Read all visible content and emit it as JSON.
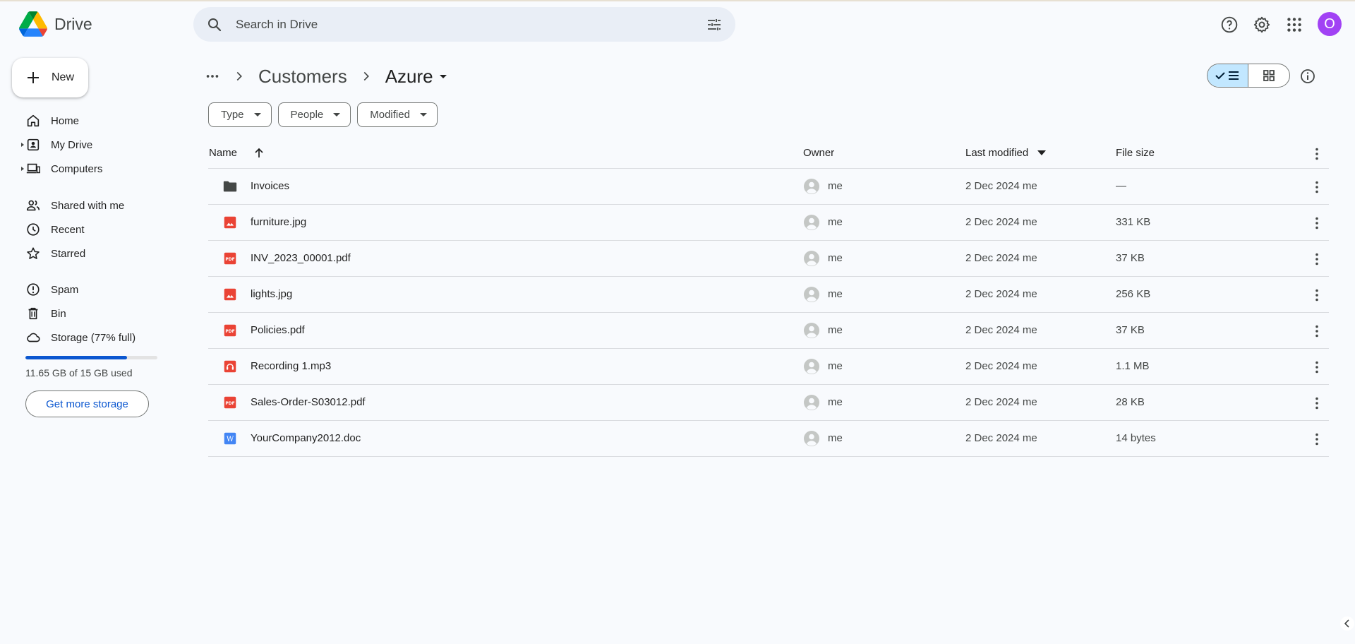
{
  "app": {
    "name": "Drive"
  },
  "search": {
    "placeholder": "Search in Drive"
  },
  "header": {
    "avatar_letter": "O",
    "accent": "#a142f4"
  },
  "sidebar": {
    "new_label": "New",
    "items": [
      {
        "label": "Home",
        "icon": "home-icon"
      },
      {
        "label": "My Drive",
        "icon": "my-drive-icon"
      },
      {
        "label": "Computers",
        "icon": "computers-icon"
      },
      {
        "label": "Shared with me",
        "icon": "shared-icon"
      },
      {
        "label": "Recent",
        "icon": "clock-icon"
      },
      {
        "label": "Starred",
        "icon": "star-icon"
      },
      {
        "label": "Spam",
        "icon": "spam-icon"
      },
      {
        "label": "Bin",
        "icon": "bin-icon"
      },
      {
        "label": "Storage (77% full)",
        "icon": "cloud-icon"
      }
    ],
    "storage_used_fraction": 0.77,
    "storage_text": "11.65 GB of 15 GB used",
    "get_storage": "Get more storage"
  },
  "breadcrumb": {
    "parent": "Customers",
    "current": "Azure"
  },
  "filters": [
    "Type",
    "People",
    "Modified"
  ],
  "table": {
    "headers": {
      "name": "Name",
      "owner": "Owner",
      "modified": "Last modified",
      "size": "File size"
    },
    "rows": [
      {
        "name": "Invoices",
        "type": "folder",
        "owner": "me",
        "modified": "2 Dec 2024 me",
        "size": "—"
      },
      {
        "name": "furniture.jpg",
        "type": "image",
        "owner": "me",
        "modified": "2 Dec 2024 me",
        "size": "331 KB"
      },
      {
        "name": "INV_2023_00001.pdf",
        "type": "pdf",
        "owner": "me",
        "modified": "2 Dec 2024 me",
        "size": "37 KB"
      },
      {
        "name": "lights.jpg",
        "type": "image",
        "owner": "me",
        "modified": "2 Dec 2024 me",
        "size": "256 KB"
      },
      {
        "name": "Policies.pdf",
        "type": "pdf",
        "owner": "me",
        "modified": "2 Dec 2024 me",
        "size": "37 KB"
      },
      {
        "name": "Recording 1.mp3",
        "type": "audio",
        "owner": "me",
        "modified": "2 Dec 2024 me",
        "size": "1.1 MB"
      },
      {
        "name": "Sales-Order-S03012.pdf",
        "type": "pdf",
        "owner": "me",
        "modified": "2 Dec 2024 me",
        "size": "28 KB"
      },
      {
        "name": "YourCompany2012.doc",
        "type": "word",
        "owner": "me",
        "modified": "2 Dec 2024 me",
        "size": "14 bytes"
      }
    ]
  }
}
